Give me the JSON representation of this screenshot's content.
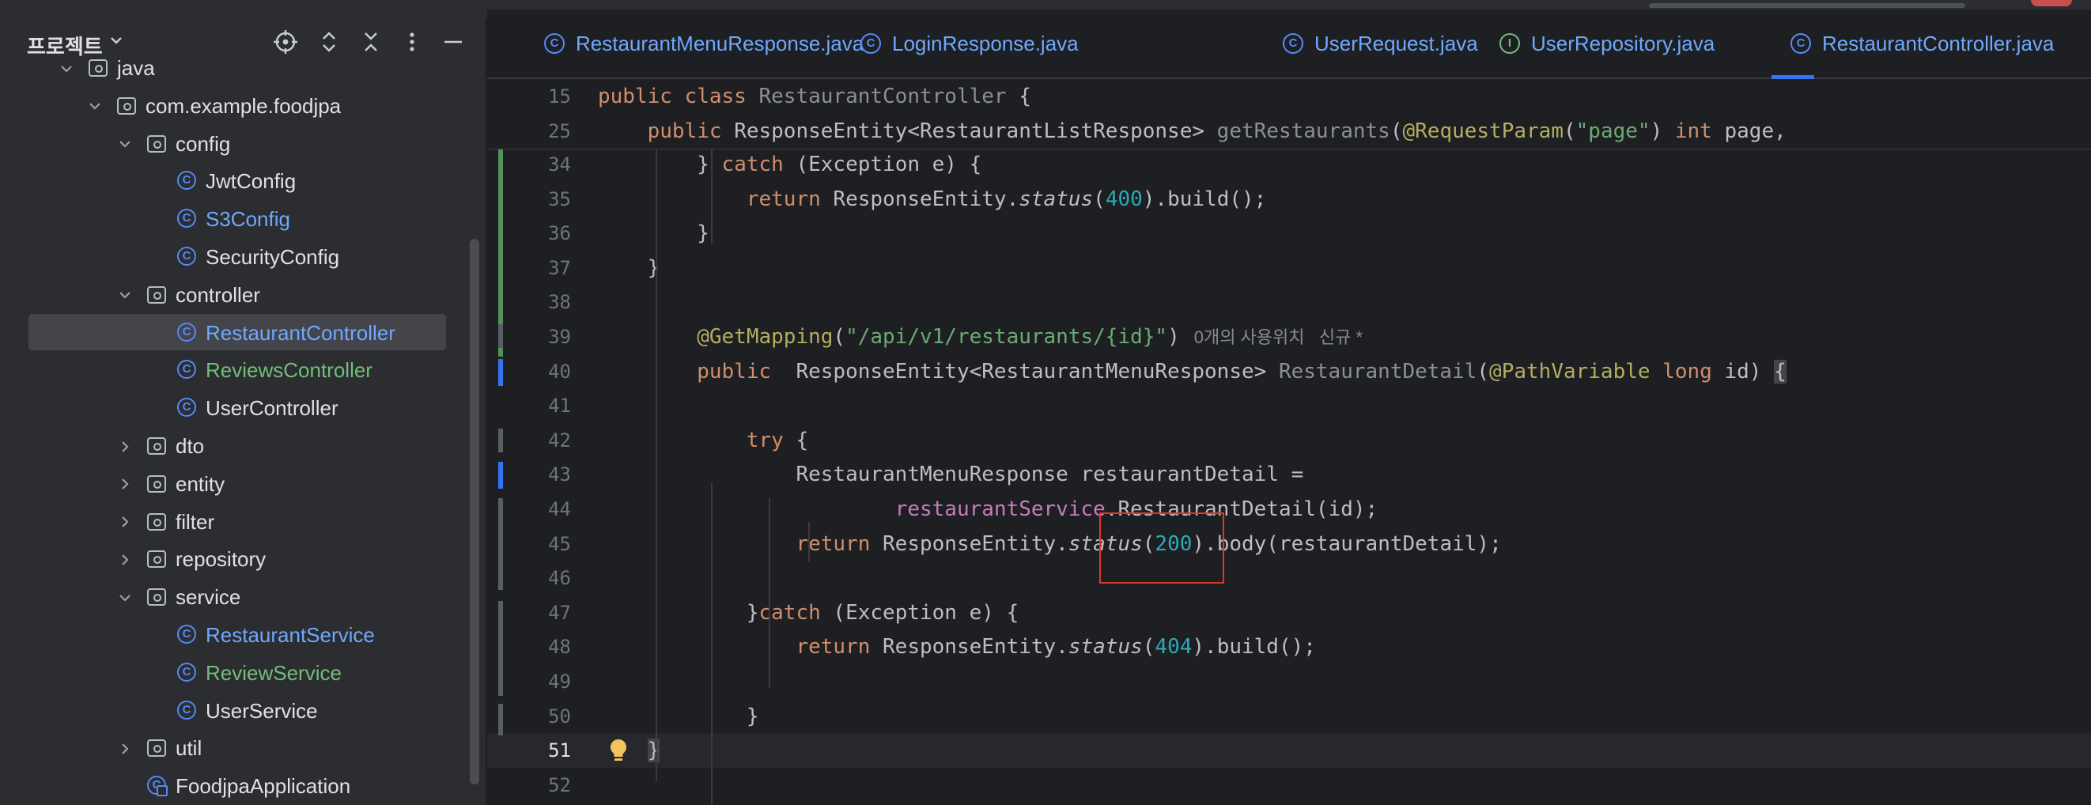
{
  "project_panel": {
    "title": "프로젝트",
    "tree": [
      {
        "label": "java",
        "type": "folder",
        "depth": 2,
        "expanded": true,
        "color": "default"
      },
      {
        "label": "com.example.foodjpa",
        "type": "folder",
        "depth": 3,
        "expanded": true,
        "color": "default"
      },
      {
        "label": "config",
        "type": "folder",
        "depth": 4,
        "expanded": true,
        "color": "default"
      },
      {
        "label": "JwtConfig",
        "type": "class",
        "depth": 5,
        "color": "default"
      },
      {
        "label": "S3Config",
        "type": "class",
        "depth": 5,
        "color": "blue"
      },
      {
        "label": "SecurityConfig",
        "type": "class",
        "depth": 5,
        "color": "default"
      },
      {
        "label": "controller",
        "type": "folder",
        "depth": 4,
        "expanded": true,
        "color": "default"
      },
      {
        "label": "RestaurantController",
        "type": "class",
        "depth": 5,
        "color": "blue",
        "selected": true
      },
      {
        "label": "ReviewsController",
        "type": "class",
        "depth": 5,
        "color": "green"
      },
      {
        "label": "UserController",
        "type": "class",
        "depth": 5,
        "color": "default"
      },
      {
        "label": "dto",
        "type": "folder",
        "depth": 4,
        "expanded": false,
        "color": "default"
      },
      {
        "label": "entity",
        "type": "folder",
        "depth": 4,
        "expanded": false,
        "color": "default"
      },
      {
        "label": "filter",
        "type": "folder",
        "depth": 4,
        "expanded": false,
        "color": "default"
      },
      {
        "label": "repository",
        "type": "folder",
        "depth": 4,
        "expanded": false,
        "color": "default"
      },
      {
        "label": "service",
        "type": "folder",
        "depth": 4,
        "expanded": true,
        "color": "default"
      },
      {
        "label": "RestaurantService",
        "type": "class",
        "depth": 5,
        "color": "blue"
      },
      {
        "label": "ReviewService",
        "type": "class",
        "depth": 5,
        "color": "green"
      },
      {
        "label": "UserService",
        "type": "class",
        "depth": 5,
        "color": "default"
      },
      {
        "label": "util",
        "type": "folder",
        "depth": 4,
        "expanded": false,
        "color": "default"
      },
      {
        "label": "FoodjpaApplication",
        "type": "app",
        "depth": 4,
        "color": "default"
      }
    ]
  },
  "tabs": [
    {
      "label": "RestaurantMenuResponse.java",
      "icon": "class",
      "active": false
    },
    {
      "label": "LoginResponse.java",
      "icon": "class",
      "active": false
    },
    {
      "label": "UserRequest.java",
      "icon": "class",
      "active": false
    },
    {
      "label": "UserRepository.java",
      "icon": "interface",
      "active": false
    },
    {
      "label": "RestaurantController.java",
      "icon": "class",
      "active": true
    }
  ],
  "icons": {
    "class_glyph": "C",
    "interface_glyph": "I",
    "crosshair": "crosshair-icon",
    "expand": "expand-all-icon",
    "collapse": "collapse-all-icon",
    "more": "more-options-icon",
    "minimize": "minimize-icon"
  },
  "editor": {
    "sticky_lines": [
      {
        "num": "15",
        "segments": [
          [
            "kw",
            "public class "
          ],
          [
            "dim",
            "RestaurantController"
          ],
          [
            "cls",
            " {"
          ]
        ]
      },
      {
        "num": "25",
        "segments": [
          [
            "kw",
            "    public "
          ],
          [
            "cls",
            "ResponseEntity<RestaurantListResponse> "
          ],
          [
            "fn",
            "getRestaurants"
          ],
          [
            "cls",
            "("
          ],
          [
            "ann",
            "@RequestParam"
          ],
          [
            "cls",
            "("
          ],
          [
            "str",
            "\"page\""
          ],
          [
            "cls",
            ") "
          ],
          [
            "kw",
            "int "
          ],
          [
            "cls",
            "page,"
          ]
        ]
      }
    ],
    "lines": [
      {
        "num": "34",
        "segments": [
          [
            "cls",
            "        } "
          ],
          [
            "kw",
            "catch "
          ],
          [
            "cls",
            "(Exception e) {"
          ]
        ]
      },
      {
        "num": "35",
        "segments": [
          [
            "kw",
            "            return "
          ],
          [
            "cls",
            "ResponseEntity."
          ],
          [
            "it",
            "status"
          ],
          [
            "cls",
            "("
          ],
          [
            "num",
            "400"
          ],
          [
            "cls",
            ").build();"
          ]
        ]
      },
      {
        "num": "36",
        "segments": [
          [
            "cls",
            "        }"
          ]
        ]
      },
      {
        "num": "37",
        "segments": [
          [
            "cls",
            "    }"
          ]
        ]
      },
      {
        "num": "38",
        "segments": []
      },
      {
        "num": "39",
        "segments": [
          [
            "ann",
            "        @GetMapping"
          ],
          [
            "cls",
            "("
          ],
          [
            "str",
            "\"/api/v1/restaurants/{id}\""
          ],
          [
            "cls",
            ")"
          ]
        ],
        "hint": "0개의 사용위치   신규 *"
      },
      {
        "num": "40",
        "segments": [
          [
            "kw",
            "        public  "
          ],
          [
            "cls",
            "ResponseEntity<RestaurantMenuResponse> "
          ],
          [
            "fn",
            "RestaurantDetail"
          ],
          [
            "cls",
            "("
          ],
          [
            "ann",
            "@PathVariable "
          ],
          [
            "kw",
            "long "
          ],
          [
            "cls",
            "id) "
          ],
          [
            "brace",
            "{"
          ]
        ]
      },
      {
        "num": "41",
        "segments": []
      },
      {
        "num": "42",
        "segments": [
          [
            "kw",
            "            try "
          ],
          [
            "cls",
            "{"
          ]
        ]
      },
      {
        "num": "43",
        "segments": [
          [
            "cls",
            "                RestaurantMenuResponse restaurantDetail ="
          ]
        ]
      },
      {
        "num": "44",
        "segments": [
          [
            "cls",
            "                        "
          ],
          [
            "field",
            "restaurantService"
          ],
          [
            "cls",
            ".RestaurantDetail(id);"
          ]
        ]
      },
      {
        "num": "45",
        "segments": [
          [
            "kw",
            "                return "
          ],
          [
            "cls",
            "ResponseEntity."
          ],
          [
            "it",
            "status"
          ],
          [
            "cls",
            "("
          ],
          [
            "num",
            "200"
          ],
          [
            "cls",
            ").body(restaurantDetail);"
          ]
        ]
      },
      {
        "num": "46",
        "segments": []
      },
      {
        "num": "47",
        "segments": [
          [
            "cls",
            "            }"
          ],
          [
            "kw",
            "catch "
          ],
          [
            "cls",
            "(Exception e) {"
          ]
        ]
      },
      {
        "num": "48",
        "segments": [
          [
            "kw",
            "                return "
          ],
          [
            "cls",
            "ResponseEntity."
          ],
          [
            "it",
            "status"
          ],
          [
            "cls",
            "("
          ],
          [
            "num",
            "404"
          ],
          [
            "cls",
            ").build();"
          ]
        ]
      },
      {
        "num": "49",
        "segments": []
      },
      {
        "num": "50",
        "segments": [
          [
            "cls",
            "            }"
          ]
        ]
      },
      {
        "num": "51",
        "segments": [
          [
            "brace",
            "    }"
          ]
        ],
        "current": true
      },
      {
        "num": "52",
        "segments": []
      }
    ]
  }
}
